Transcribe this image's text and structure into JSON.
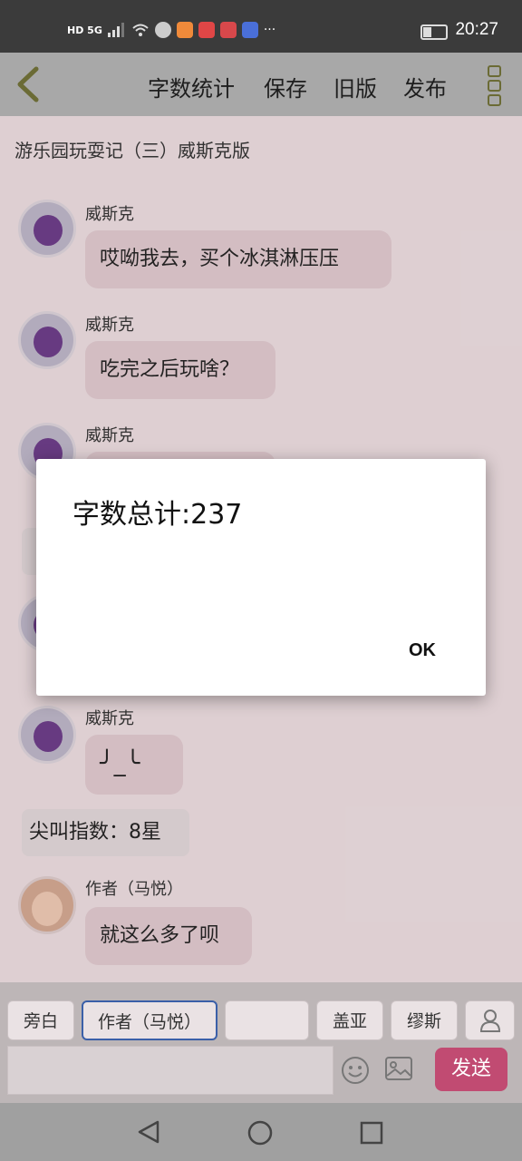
{
  "status_bar": {
    "time": "20:27",
    "network": "HD 5G",
    "more": "···"
  },
  "toolbar": {
    "word_count": "字数统计",
    "save": "保存",
    "old_version": "旧版",
    "publish": "发布"
  },
  "story_title": "游乐园玩耍记（三）威斯克版",
  "messages": [
    {
      "sender": "威斯克",
      "text": "哎呦我去，买个冰淇淋压压"
    },
    {
      "sender": "威斯克",
      "text": "吃完之后玩啥？"
    },
    {
      "sender": "威斯克",
      "text": ""
    },
    {
      "sender": "威斯克",
      "text": "╯_╰"
    },
    {
      "narration": "尖叫指数：8星"
    },
    {
      "sender": "作者（马悦）",
      "text": "就这么多了呗"
    }
  ],
  "dialog": {
    "title": "字数总计:237",
    "ok_label": "OK"
  },
  "roles": [
    "旁白",
    "作者（马悦）",
    "",
    "盖亚",
    "缪斯"
  ],
  "send_label": "发送",
  "colors": {
    "send_button": "#c14b72",
    "selected_role_border": "#3a5fa8"
  }
}
